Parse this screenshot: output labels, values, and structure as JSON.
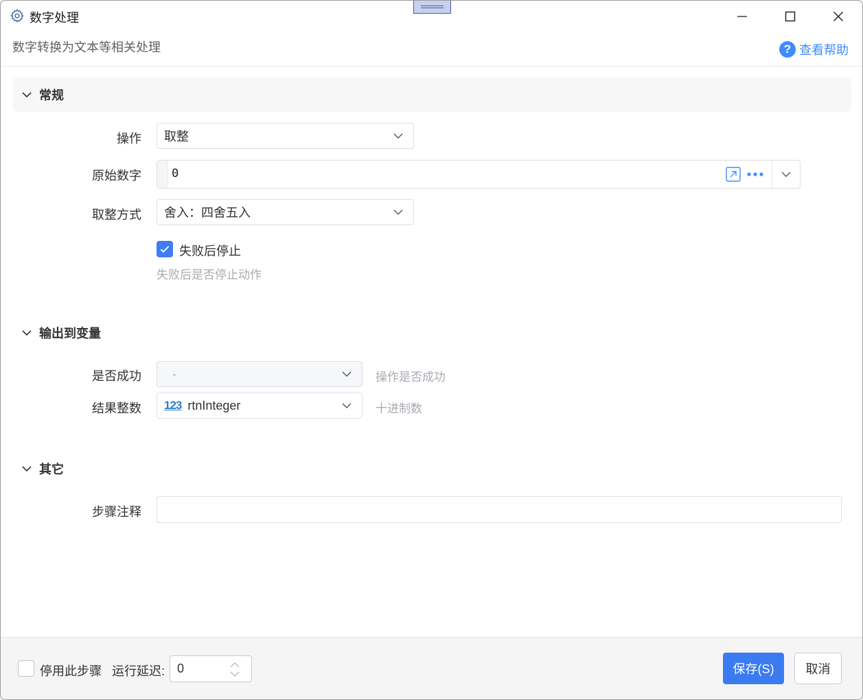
{
  "window": {
    "title": "数字处理",
    "subtitle": "数字转换为文本等相关处理",
    "help_label": "查看帮助",
    "help_icon": "question-circle-icon"
  },
  "sections": {
    "general": "常规",
    "output": "输出到变量",
    "other": "其它"
  },
  "general": {
    "operation_label": "操作",
    "operation_value": "取整",
    "number_label": "原始数字",
    "number_value": "0",
    "rounding_label": "取整方式",
    "rounding_value": "舍入：四舍五入",
    "stop_on_fail_label": "失败后停止",
    "stop_on_fail_checked": true,
    "stop_on_fail_hint": "失败后是否停止动作"
  },
  "output": {
    "success_label": "是否成功",
    "success_value": "-",
    "success_hint": "操作是否成功",
    "result_label": "结果整数",
    "result_icon_text": "123",
    "result_value": "rtnInteger",
    "result_hint": "十进制数"
  },
  "other": {
    "comment_label": "步骤注释",
    "comment_value": ""
  },
  "footer": {
    "disable_label": "停用此步骤",
    "delay_label": "运行延迟:",
    "delay_value": "0",
    "save_label": "保存(S)",
    "cancel_label": "取消"
  },
  "colors": {
    "accent": "#3b7bf2",
    "link": "#3f8cff",
    "hint": "#a8abb2"
  }
}
